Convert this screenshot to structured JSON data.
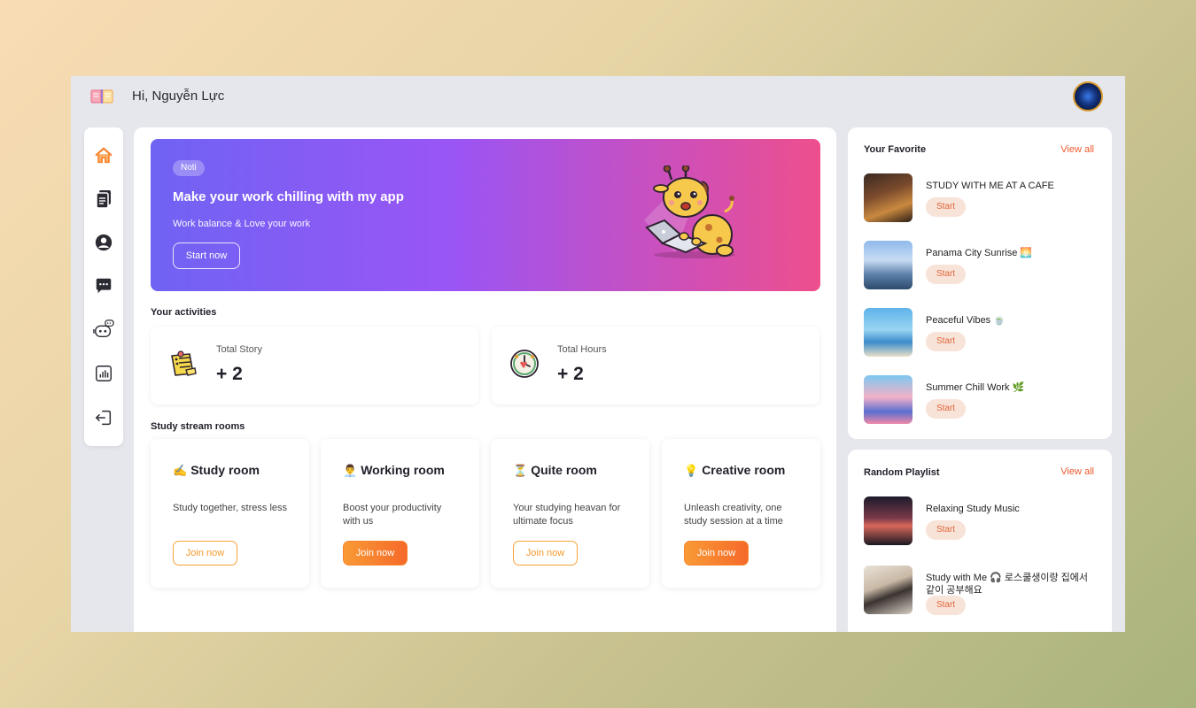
{
  "header": {
    "greeting": "Hi, Nguyễn Lực"
  },
  "sidebar": {
    "items": [
      {
        "icon": "home-icon"
      },
      {
        "icon": "documents-icon"
      },
      {
        "icon": "user-icon"
      },
      {
        "icon": "chat-icon"
      },
      {
        "icon": "robot-icon"
      },
      {
        "icon": "chart-icon"
      },
      {
        "icon": "logout-icon"
      }
    ],
    "active_color": "#f7842f"
  },
  "banner": {
    "badge": "Noti",
    "title": "Make your work chilling with my app",
    "subtitle": "Work balance & Love your work",
    "button": "Start now"
  },
  "activities": {
    "title": "Your activities",
    "stats": [
      {
        "label": "Total Story",
        "value": "+ 2",
        "icon": "notepad-icon"
      },
      {
        "label": "Total Hours",
        "value": "+ 2",
        "icon": "clock-icon"
      }
    ]
  },
  "rooms": {
    "title": "Study stream rooms",
    "items": [
      {
        "emoji": "✍️",
        "title": "Study room",
        "desc": "Study together, stress less",
        "button": "Join now",
        "style": "outline"
      },
      {
        "emoji": "👨‍💼",
        "title": "Working room",
        "desc": "Boost your productivity with us",
        "button": "Join now",
        "style": "fill"
      },
      {
        "emoji": "⏳",
        "title": "Quite room",
        "desc": "Your studying heavan for ultimate focus",
        "button": "Join now",
        "style": "outline"
      },
      {
        "emoji": "💡",
        "title": "Creative room",
        "desc": "Unleash creativity, one study session at a time",
        "button": "Join now",
        "style": "fill"
      }
    ]
  },
  "favorite": {
    "title": "Your Favorite",
    "view_all": "View all",
    "items": [
      {
        "name": "STUDY WITH ME AT A CAFE",
        "button": "Start"
      },
      {
        "name": "Panama City Sunrise 🌅",
        "button": "Start"
      },
      {
        "name": "Peaceful Vibes 🍵",
        "button": "Start"
      },
      {
        "name": "Summer Chill Work 🌿",
        "button": "Start"
      }
    ]
  },
  "playlist": {
    "title": "Random Playlist",
    "view_all": "View all",
    "items": [
      {
        "name": "Relaxing Study Music",
        "button": "Start"
      },
      {
        "name": "Study with Me 🎧 로스쿨생이랑 집에서 같이 공부해요",
        "button": "Start"
      }
    ]
  }
}
